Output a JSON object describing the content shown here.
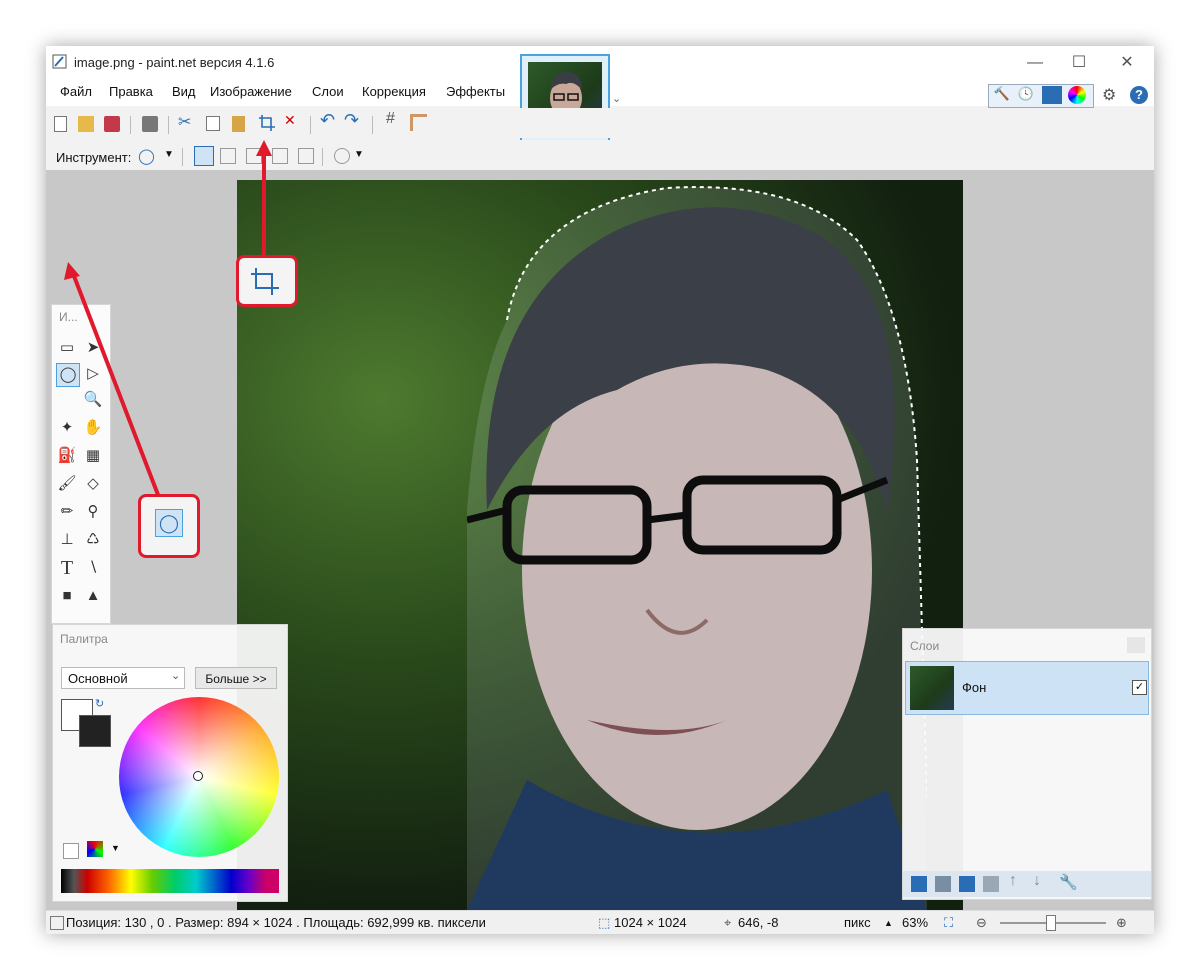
{
  "window": {
    "title": "image.png - paint.net версия 4.1.6"
  },
  "menu": [
    {
      "label": "Файл",
      "key": "Ф"
    },
    {
      "label": "Правка",
      "key": "П"
    },
    {
      "label": "Вид",
      "key": "В"
    },
    {
      "label": "Изображение",
      "key": "И"
    },
    {
      "label": "Слои",
      "key": "С"
    },
    {
      "label": "Коррекция",
      "key": "К"
    },
    {
      "label": "Эффекты",
      "key": "Э"
    }
  ],
  "toolbar": {
    "tool_label": "Инструмент:"
  },
  "tools_panel": {
    "title": "И..."
  },
  "palette": {
    "title": "Палитра",
    "select_value": "Основной",
    "more_label": "Больше >>"
  },
  "layers": {
    "title": "Слои",
    "items": [
      {
        "name": "Фон",
        "visible": true
      }
    ]
  },
  "status": {
    "position": "Позиция: 130 , 0 . Размер: 894  × 1024 . Площадь: 692,999 кв. пиксели",
    "image_size": "1024 × 1024",
    "cursor": "646, -8",
    "units": "пикс",
    "zoom": "63%"
  },
  "colors": {
    "accent": "#4aa3df",
    "callout": "#e0192c",
    "selection_bg": "#cde3f5"
  }
}
